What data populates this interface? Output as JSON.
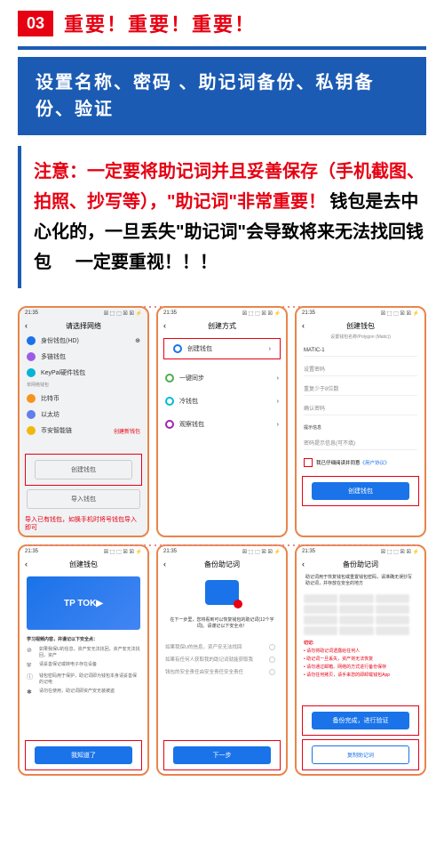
{
  "badge": "03",
  "important": "重要！重要！重要！",
  "header": "设置名称、密码 、助记词备份、私钥备份、验证",
  "note": {
    "red1": "注意：一定要将助记词并且妥善保存（手机截图、拍照、抄写等），\"助记词\"非常重要！",
    "black1": "钱包是去中心化的，一旦丢失\"助记词\"会导致将来无法找回钱包",
    "black2": "一定要重视！！！"
  },
  "phones": {
    "p1": {
      "time": "21:35",
      "title": "请选择网络",
      "items": [
        "身份钱包(HD)",
        "多链钱包",
        "KeyPal硬件钱包"
      ],
      "sect": "单网络钱包",
      "coins": [
        "比特币",
        "以太坊",
        "币安智能链"
      ],
      "create_label": "创建新钱包",
      "btn1": "创建钱包",
      "btn2": "导入钱包",
      "caption": "导入已有钱包，如换手机时将号钱包导入即可"
    },
    "p2": {
      "time": "21:35",
      "title": "创建方式",
      "opts": [
        "创建钱包",
        "一键同步",
        "冷钱包",
        "观察钱包"
      ]
    },
    "p3": {
      "time": "21:35",
      "title": "创建钱包",
      "sub": "设置钱包名称/Polygon (Matic))",
      "name": "MATIC-1",
      "f1": "设置密码",
      "f2": "重复少于8位数",
      "f3": "确认密码",
      "hint_label": "提示信息",
      "hint": "密码提示信息(可不填)",
      "agree": "我已仔细阅读并同意",
      "agree_link": "《用户协议》",
      "btn": "创建钱包"
    },
    "p4": {
      "time": "21:35",
      "title": "创建钱包",
      "h": "学习视频内容，并谨记以下安全点：",
      "tips": [
        "如果我保U的信息，资产安无法找回，资产安无法找回，资产",
        "请妥善保记或转电子存在设备",
        "钱包密码用于保护，助记词即为钱包本身请妥善保的记电",
        "请勿在使用，助记词即资产安无装被盗"
      ],
      "btn": "我知道了"
    },
    "p5": {
      "time": "21:35",
      "title": "备份助记词",
      "desc": "在下一步里，您将看到可以恢复钱包的助记词(12个字词)。请谨记以下安全点！",
      "chk1": "如果我保U的信息，资产安无法找回",
      "chk2": "如果有任何人获取我的助记词就能获取我",
      "chk3": "钱包的安全责任由安全责任安全责任",
      "btn": "下一步"
    },
    "p6": {
      "time": "21:35",
      "title": "备份助记词",
      "desc": "助记词用于恢复钱包或重置钱包密码，请准确无误抄写助记词，并存放在安全的地方",
      "warn_label": "切记:",
      "warns": [
        "请勿将助记词透露给任何人",
        "助记词一旦丢失，资产将无法恢复",
        "请勿通过邮箱、网络的方式进行备份保存",
        "请勿任何拷贝，请手来您的即卸载钱包App"
      ],
      "btn": "备份完成，进行验证",
      "btn2": "复制助记词"
    }
  }
}
